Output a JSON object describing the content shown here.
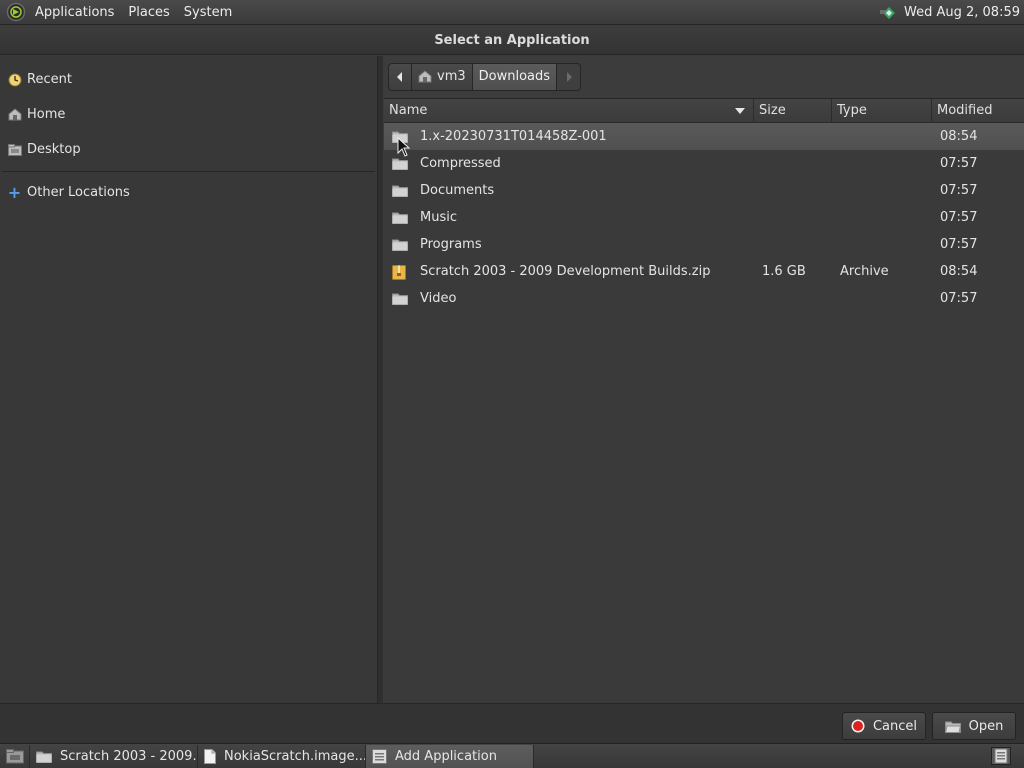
{
  "top_panel": {
    "menus": [
      "Applications",
      "Places",
      "System"
    ],
    "clock": "Wed Aug  2, 08:59"
  },
  "dialog": {
    "title": "Select an Application",
    "sidebar": {
      "items": [
        {
          "label": "Recent",
          "icon": "recent-icon"
        },
        {
          "label": "Home",
          "icon": "home-icon"
        },
        {
          "label": "Desktop",
          "icon": "desktop-icon"
        }
      ],
      "other_locations": {
        "label": "Other Locations",
        "icon": "plus-icon"
      }
    },
    "pathbar": {
      "segments": [
        "vm3",
        "Downloads"
      ]
    },
    "columns": {
      "name": "Name",
      "size": "Size",
      "type": "Type",
      "modified": "Modified"
    },
    "files": [
      {
        "name": "1.x-20230731T014458Z-001",
        "size": "",
        "type": "",
        "modified": "08:54",
        "icon": "folder-icon",
        "selected": true
      },
      {
        "name": "Compressed",
        "size": "",
        "type": "",
        "modified": "07:57",
        "icon": "folder-icon"
      },
      {
        "name": "Documents",
        "size": "",
        "type": "",
        "modified": "07:57",
        "icon": "folder-icon"
      },
      {
        "name": "Music",
        "size": "",
        "type": "",
        "modified": "07:57",
        "icon": "folder-icon"
      },
      {
        "name": "Programs",
        "size": "",
        "type": "",
        "modified": "07:57",
        "icon": "folder-icon"
      },
      {
        "name": "Scratch 2003 - 2009 Development Builds.zip",
        "size": "1.6 GB",
        "type": "Archive",
        "modified": "08:54",
        "icon": "archive-icon"
      },
      {
        "name": "Video",
        "size": "",
        "type": "",
        "modified": "07:57",
        "icon": "folder-icon"
      }
    ],
    "buttons": {
      "cancel": "Cancel",
      "open": "Open"
    }
  },
  "taskbar": {
    "tasks": [
      {
        "label": "Scratch 2003 - 2009...",
        "icon": "folder-icon"
      },
      {
        "label": "NokiaScratch.image...",
        "icon": "document-icon"
      },
      {
        "label": "Add Application",
        "icon": "window-icon",
        "active": true
      }
    ]
  },
  "colors": {
    "background": "#3c3c3c",
    "selection": "#555555",
    "folder": "#cfcfcf",
    "archive": "#e8b54a",
    "cancel_red": "#e02020"
  }
}
